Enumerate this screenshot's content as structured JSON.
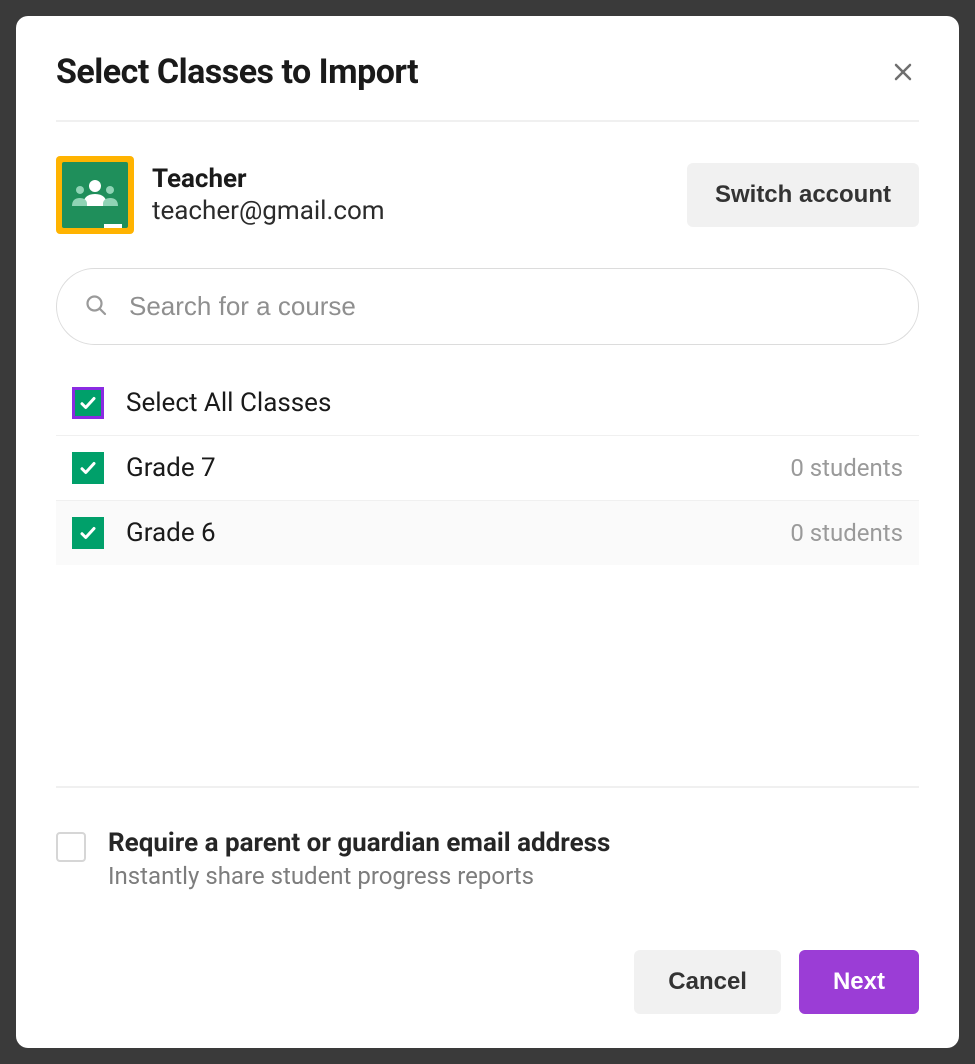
{
  "modal": {
    "title": "Select Classes to Import"
  },
  "account": {
    "name": "Teacher",
    "email": "teacher@gmail.com",
    "switch_label": "Switch account"
  },
  "search": {
    "placeholder": "Search for a course"
  },
  "list": {
    "select_all_label": "Select All Classes",
    "classes": [
      {
        "name": "Grade 7",
        "students": "0 students"
      },
      {
        "name": "Grade 6",
        "students": "0 students"
      }
    ]
  },
  "require": {
    "title": "Require a parent or guardian email address",
    "subtitle": "Instantly share student progress reports"
  },
  "footer": {
    "cancel": "Cancel",
    "next": "Next"
  }
}
